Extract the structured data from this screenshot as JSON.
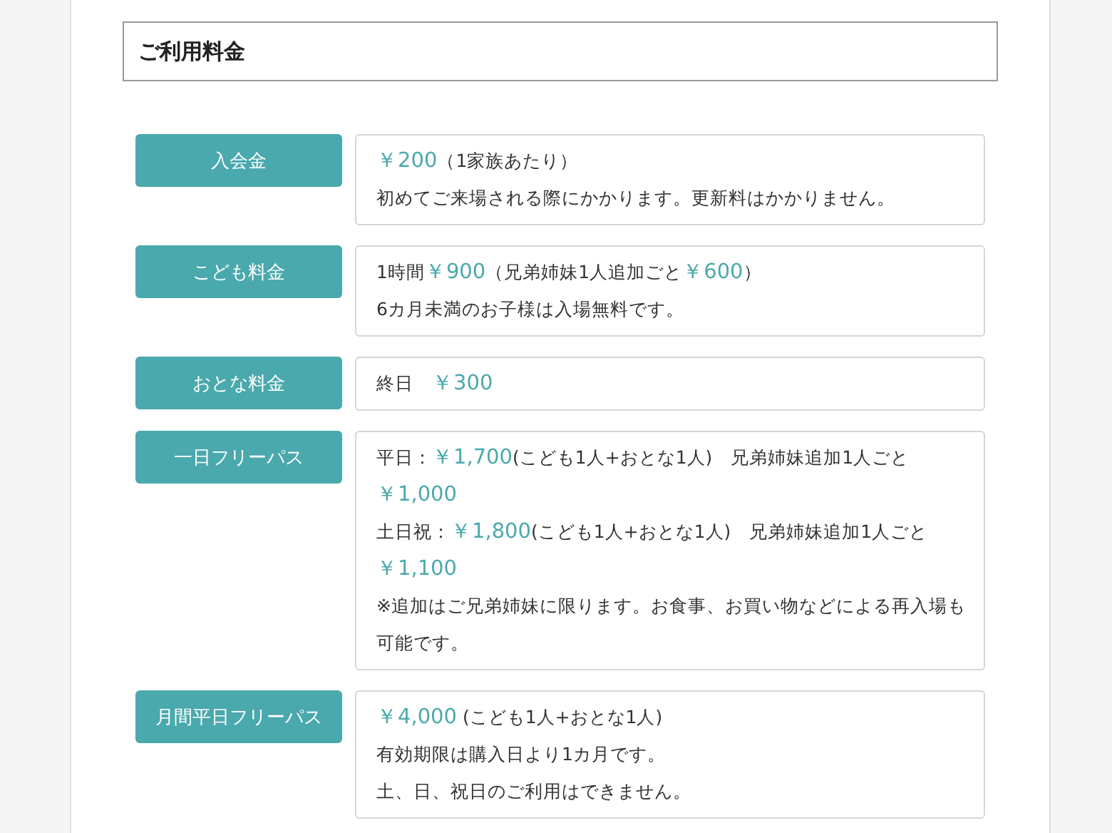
{
  "heading": "ご利用料金",
  "fees": [
    {
      "label": "入会金",
      "lines": [
        [
          {
            "kind": "price",
            "text": "￥200"
          },
          {
            "kind": "text",
            "text": "（1家族あたり）"
          }
        ],
        [
          {
            "kind": "text",
            "text": "初めてご来場される際にかかります。更新料はかかりません。"
          }
        ]
      ]
    },
    {
      "label": "こども料金",
      "lines": [
        [
          {
            "kind": "text",
            "text": "1時間"
          },
          {
            "kind": "price",
            "text": "￥900"
          },
          {
            "kind": "text",
            "text": "（兄弟姉妹1人追加ごと"
          },
          {
            "kind": "price",
            "text": "￥600"
          },
          {
            "kind": "text",
            "text": "）"
          }
        ],
        [
          {
            "kind": "text",
            "text": "6カ月未満のお子様は入場無料です。"
          }
        ]
      ]
    },
    {
      "label": "おとな料金",
      "lines": [
        [
          {
            "kind": "text",
            "text": "終日　"
          },
          {
            "kind": "price",
            "text": "￥300"
          }
        ]
      ]
    },
    {
      "label": "一日フリーパス",
      "lines": [
        [
          {
            "kind": "text",
            "text": "平日："
          },
          {
            "kind": "price",
            "text": "￥1,700"
          },
          {
            "kind": "text",
            "text": "(こども1人+おとな1人)　兄弟姉妹追加1人ごと"
          }
        ],
        [
          {
            "kind": "price",
            "text": "￥1,000"
          }
        ],
        [
          {
            "kind": "text",
            "text": "土日祝："
          },
          {
            "kind": "price",
            "text": "￥1,800"
          },
          {
            "kind": "text",
            "text": "(こども1人+おとな1人)　兄弟姉妹追加1人ごと"
          }
        ],
        [
          {
            "kind": "price",
            "text": "￥1,100"
          }
        ],
        [
          {
            "kind": "text",
            "text": "※追加はご兄弟姉妹に限ります。お食事、お買い物などによる再入場も可能です。"
          }
        ]
      ]
    },
    {
      "label": "月間平日フリーパス",
      "lines": [
        [
          {
            "kind": "price",
            "text": "￥4,000"
          },
          {
            "kind": "text",
            "text": " (こども1人+おとな1人)"
          }
        ],
        [
          {
            "kind": "text",
            "text": "有効期限は購入日より1カ月です。"
          }
        ],
        [
          {
            "kind": "text",
            "text": "土、日、祝日のご利用はできません。"
          }
        ]
      ]
    }
  ]
}
